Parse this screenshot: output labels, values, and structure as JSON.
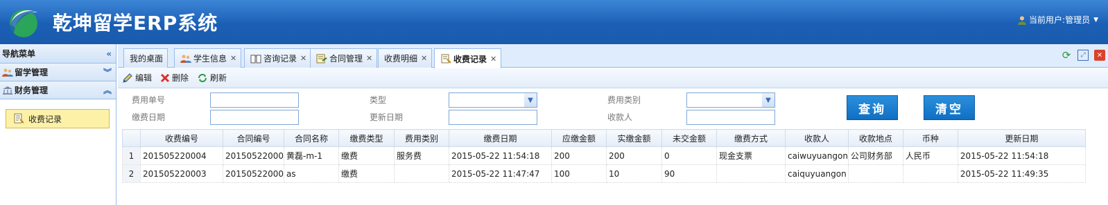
{
  "header": {
    "title": "乾坤留学ERP系统",
    "user_label": "当前用户:管理员"
  },
  "sidebar": {
    "title": "导航菜单",
    "sections": [
      {
        "label": "留学管理",
        "icon": "user-group-icon"
      },
      {
        "label": "财务管理",
        "icon": "bank-icon"
      }
    ],
    "items": [
      {
        "label": "收费记录",
        "icon": "document-icon"
      }
    ]
  },
  "tabs": [
    {
      "label": "我的桌面",
      "icon": "",
      "closable": false
    },
    {
      "label": "学生信息",
      "icon": "users-icon",
      "closable": true
    },
    {
      "label": "咨询记录",
      "icon": "book-icon",
      "closable": true
    },
    {
      "label": "合同管理",
      "icon": "contract-icon",
      "closable": true
    },
    {
      "label": "收费明细",
      "icon": "",
      "closable": true
    },
    {
      "label": "收费记录",
      "icon": "document-icon",
      "closable": true,
      "active": true
    }
  ],
  "toolbar": {
    "edit": "编辑",
    "delete": "删除",
    "refresh": "刷新"
  },
  "filters": {
    "fee_no": "费用单号",
    "type": "类型",
    "fee_category": "费用类别",
    "pay_date": "缴费日期",
    "update_date": "更新日期",
    "payee": "收款人",
    "search": "查询",
    "clear": "清空"
  },
  "grid": {
    "columns": [
      "收费编号",
      "合同编号",
      "合同名称",
      "缴费类型",
      "费用类别",
      "缴费日期",
      "应缴金额",
      "实缴金额",
      "未交金额",
      "缴费方式",
      "收款人",
      "收款地点",
      "币种",
      "更新日期"
    ],
    "rows": [
      {
        "n": "1",
        "cells": [
          "201505220004",
          "20150522000",
          "黄磊-m-1",
          "缴费",
          "服务费",
          "2015-05-22 11:54:18",
          "200",
          "200",
          "0",
          "现金支票",
          "caiwuyuangon",
          "公司财务部",
          "人民币",
          "2015-05-22 11:54:18"
        ]
      },
      {
        "n": "2",
        "cells": [
          "201505220003",
          "20150522000",
          "as",
          "缴费",
          "",
          "2015-05-22 11:47:47",
          "100",
          "10",
          "90",
          "",
          "caiquyuangon",
          "",
          "",
          "2015-05-22 11:49:35"
        ]
      }
    ]
  }
}
